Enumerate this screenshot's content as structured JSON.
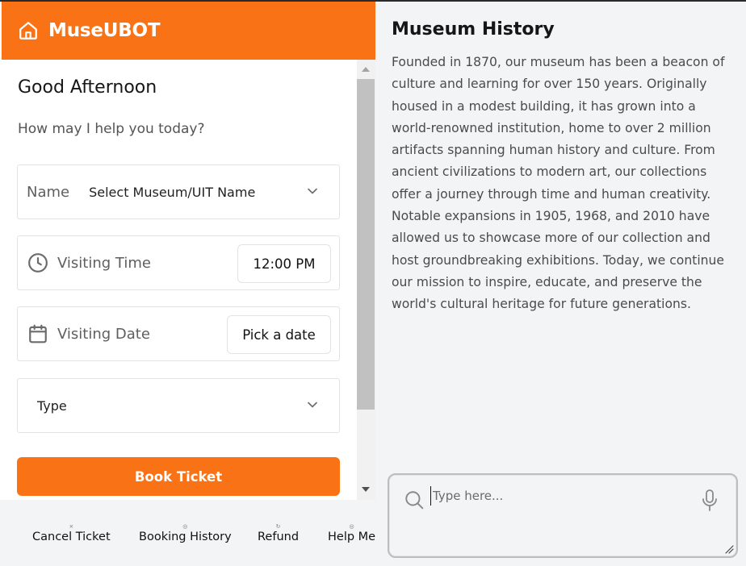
{
  "app": {
    "title": "MuseUBOT"
  },
  "icons": {
    "home": "home-icon",
    "clock": "clock-icon",
    "calendar": "calendar-icon",
    "chevron": "chevron-down-icon",
    "search": "search-icon",
    "mic": "microphone-icon"
  },
  "colors": {
    "brand": "#f97316",
    "panel_bg": "#f3f4f6"
  },
  "main": {
    "greeting": "Good Afternoon",
    "subtitle": "How may I help you today?",
    "name_label": "Name",
    "name_selected": "Select Museum/UIT Name",
    "time_label": "Visiting Time",
    "time_value": "12:00 PM",
    "date_label": "Visiting Date",
    "date_value": "Pick a date",
    "type_selected": "Type",
    "book_button": "Book Ticket"
  },
  "bottom_nav": [
    {
      "label": "Cancel Ticket"
    },
    {
      "label": "Booking History"
    },
    {
      "label": "Refund"
    },
    {
      "label": "Help Me"
    }
  ],
  "history": {
    "title": "Museum History",
    "body": "Founded in 1870, our museum has been a beacon of culture and learning for over 150 years. Originally housed in a modest building, it has grown into a world-renowned institution, home to over 2 million artifacts spanning human history and culture. From ancient civilizations to modern art, our collections offer a journey through time and human creativity. Notable expansions in 1905, 1968, and 2010 have allowed us to showcase more of our collection and host groundbreaking exhibitions. Today, we continue our mission to inspire, educate, and preserve the world's cultural heritage for future generations."
  },
  "chat": {
    "placeholder": "Type here...",
    "value": ""
  }
}
